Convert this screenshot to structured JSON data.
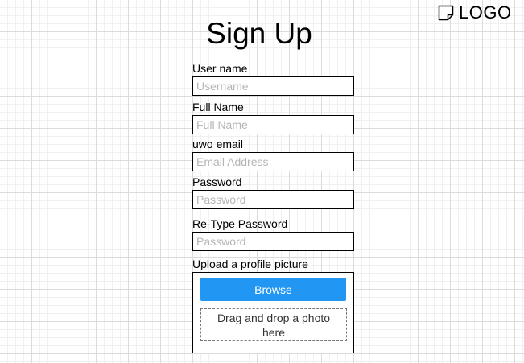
{
  "logo": {
    "text": "LOGO",
    "icon": "note-icon"
  },
  "page": {
    "title": "Sign Up"
  },
  "form": {
    "fields": [
      {
        "label": "User name",
        "placeholder": "Username",
        "value": ""
      },
      {
        "label": "Full Name",
        "placeholder": "Full Name",
        "value": ""
      },
      {
        "label": "uwo email",
        "placeholder": "Email Address",
        "value": ""
      },
      {
        "label": "Password",
        "placeholder": "Password",
        "value": ""
      },
      {
        "label": "Re-Type Password",
        "placeholder": "Password",
        "value": ""
      }
    ],
    "upload": {
      "label": "Upload a profile picture",
      "browse_label": "Browse",
      "drop_text": "Drag and drop a photo here"
    }
  },
  "colors": {
    "accent": "#2196f3",
    "grid_major": "#dcdcdc",
    "grid_minor": "#f0f0f0"
  }
}
